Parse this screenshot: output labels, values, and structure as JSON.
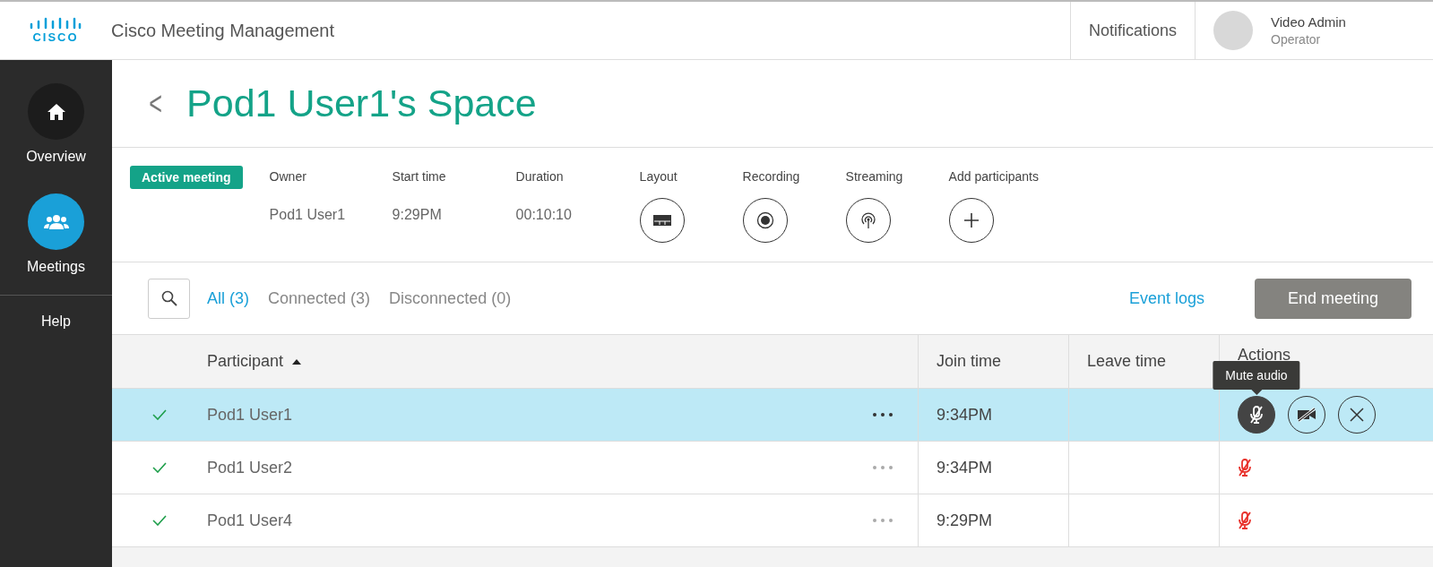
{
  "header": {
    "app_title": "Cisco Meeting Management",
    "logo_text": "CISCO",
    "notifications": "Notifications",
    "user": {
      "name": "Video Admin",
      "role": "Operator"
    }
  },
  "sidebar": {
    "items": [
      {
        "label": "Overview",
        "kind": "icon",
        "selected": false
      },
      {
        "label": "Meetings",
        "kind": "icon",
        "selected": true
      },
      {
        "label": "Help",
        "kind": "text",
        "selected": false
      }
    ]
  },
  "page": {
    "back": "<",
    "title": "Pod1 User1's Space"
  },
  "meeting": {
    "status": "Active meeting",
    "fields": [
      {
        "label": "Owner",
        "value": "Pod1 User1"
      },
      {
        "label": "Start time",
        "value": "9:29PM"
      },
      {
        "label": "Duration",
        "value": "00:10:10"
      }
    ],
    "controls": [
      {
        "label": "Layout"
      },
      {
        "label": "Recording"
      },
      {
        "label": "Streaming"
      },
      {
        "label": "Add participants"
      }
    ]
  },
  "filters": [
    {
      "label": "All (3)",
      "selected": true
    },
    {
      "label": "Connected (3)",
      "selected": false
    },
    {
      "label": "Disconnected (0)",
      "selected": false
    }
  ],
  "event_logs": "Event logs",
  "end_meeting": "End meeting",
  "table": {
    "columns": [
      "Participant",
      "Join time",
      "Leave time",
      "Actions"
    ],
    "rows": [
      {
        "connected": true,
        "name": "Pod1 User1",
        "join_time": "9:34PM",
        "leave_time": "",
        "selected": true,
        "muted": false,
        "tooltip": "Mute audio"
      },
      {
        "connected": true,
        "name": "Pod1 User2",
        "join_time": "9:34PM",
        "leave_time": "",
        "selected": false,
        "muted": true
      },
      {
        "connected": true,
        "name": "Pod1 User4",
        "join_time": "9:29PM",
        "leave_time": "",
        "selected": false,
        "muted": true
      }
    ]
  }
}
